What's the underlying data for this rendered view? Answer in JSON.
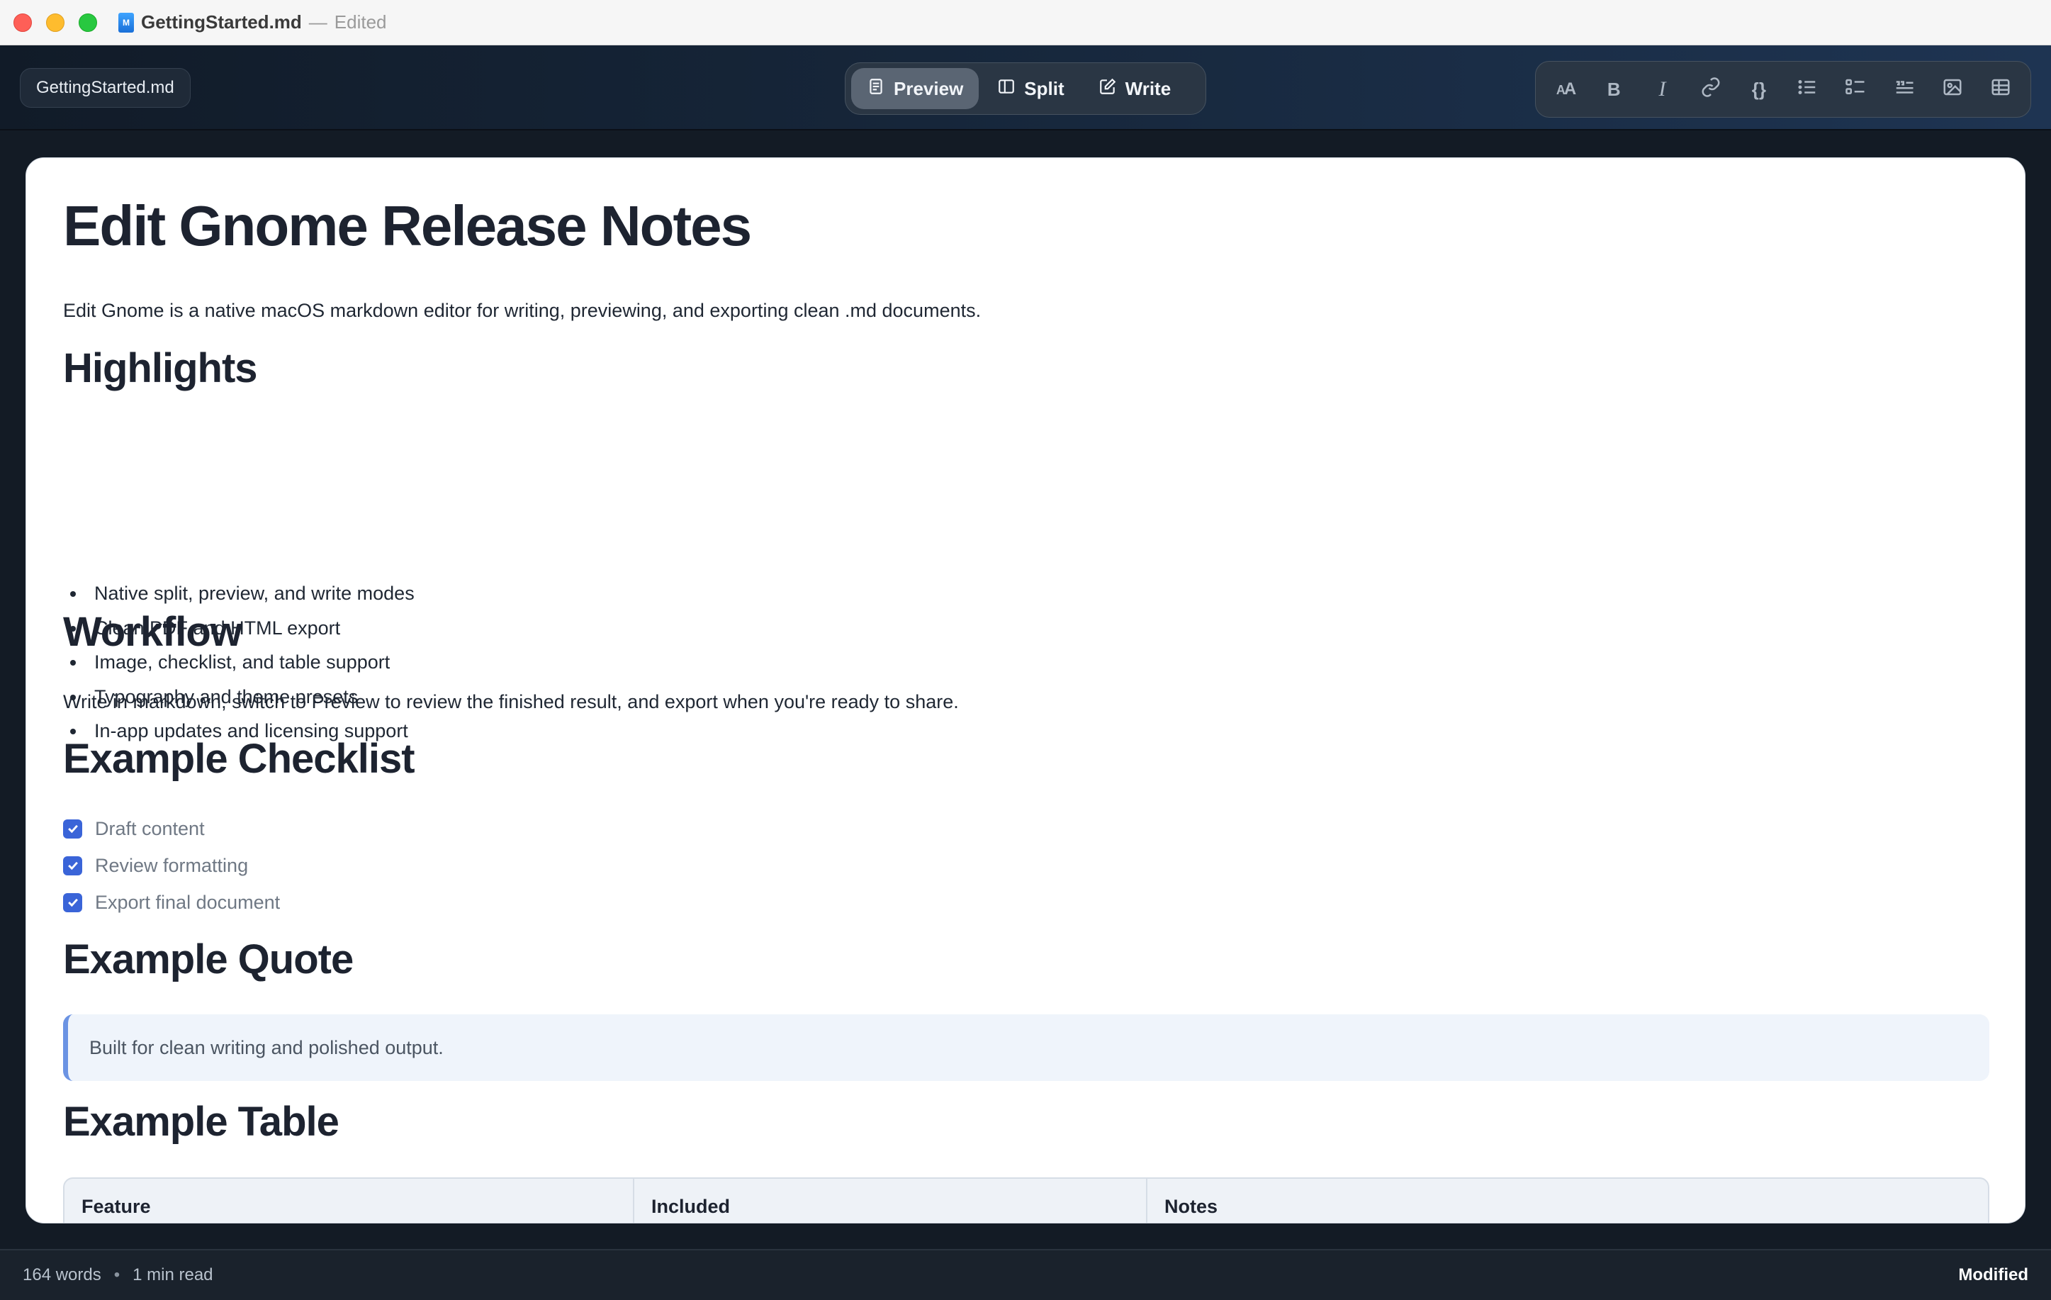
{
  "window": {
    "title": "GettingStarted.md",
    "separator": "—",
    "state": "Edited",
    "doc_icon_glyph": "M"
  },
  "toolbar": {
    "file_chip": "GettingStarted.md",
    "modes": [
      {
        "label": "Preview",
        "icon": "document-icon",
        "active": true
      },
      {
        "label": "Split",
        "icon": "split-view-icon",
        "active": false
      },
      {
        "label": "Write",
        "icon": "edit-icon",
        "active": false
      }
    ],
    "format_buttons": [
      {
        "icon": "text-size-icon",
        "glyph": "AA"
      },
      {
        "icon": "bold-icon",
        "glyph": "B"
      },
      {
        "icon": "italic-icon",
        "glyph": "I"
      },
      {
        "icon": "link-icon"
      },
      {
        "icon": "code-braces-icon",
        "glyph": "{}"
      },
      {
        "icon": "bullet-list-icon"
      },
      {
        "icon": "checklist-icon"
      },
      {
        "icon": "quote-icon"
      },
      {
        "icon": "image-icon"
      },
      {
        "icon": "table-icon"
      }
    ]
  },
  "document": {
    "title": "Edit Gnome Release Notes",
    "intro": "Edit Gnome is a native macOS markdown editor for writing, previewing, and exporting clean .md documents.",
    "highlights_heading": "Highlights",
    "highlights": [
      "Native split, preview, and write modes",
      "Clean PDF and HTML export",
      "Image, checklist, and table support",
      "Typography and theme presets",
      "In-app updates and licensing support"
    ],
    "workflow_heading": "Workflow",
    "workflow_text": "Write in markdown, switch to Preview to review the finished result, and export when you're ready to share.",
    "checklist_heading": "Example Checklist",
    "checklist": [
      {
        "label": "Draft content",
        "checked": true
      },
      {
        "label": "Review formatting",
        "checked": true
      },
      {
        "label": "Export final document",
        "checked": true
      }
    ],
    "quote_heading": "Example Quote",
    "quote": "Built for clean writing and polished output.",
    "table_heading": "Example Table",
    "table_headers": [
      "Feature",
      "Included",
      "Notes"
    ]
  },
  "status": {
    "words": "164 words",
    "bullet": "•",
    "read_time": "1 min read",
    "state": "Modified"
  },
  "colors": {
    "accent": "#3a64d8",
    "quote_border": "#6b93e3",
    "traffic_close": "#fe5f57",
    "traffic_minimize": "#febc2e",
    "traffic_maximize": "#28c840"
  }
}
